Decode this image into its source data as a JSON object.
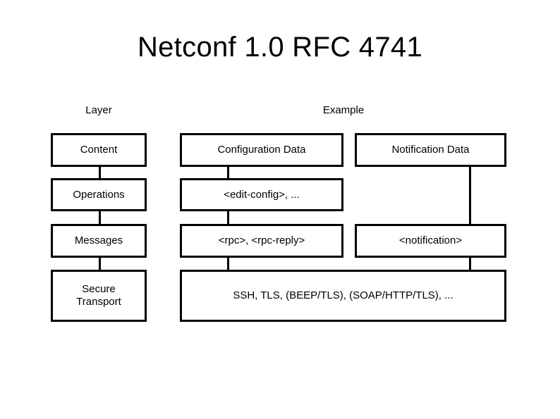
{
  "slide": {
    "title": "Netconf 1.0 RFC 4741",
    "background_color": "#ffffff",
    "line_color": "#000000"
  },
  "columns": {
    "layer_header": "Layer",
    "example_header": "Example"
  },
  "diagram": {
    "type": "layered-block-diagram",
    "layers": [
      {
        "layer": "Content",
        "examples": [
          "Configuration Data",
          "Notification Data"
        ]
      },
      {
        "layer": "Operations",
        "examples": [
          "<edit-config>, ..."
        ]
      },
      {
        "layer": "Messages",
        "examples": [
          "<rpc>, <rpc-reply>",
          "<notification>"
        ]
      },
      {
        "layer": "Secure\nTransport",
        "examples": [
          "SSH, TLS, (BEEP/TLS), (SOAP/HTTP/TLS), ..."
        ]
      }
    ],
    "layer_boxes": {
      "content": "Content",
      "operations": "Operations",
      "messages": "Messages",
      "secure_transport": "Secure\nTransport"
    },
    "example_boxes": {
      "configuration_data": "Configuration Data",
      "notification_data": "Notification Data",
      "edit_config": "<edit-config>, ...",
      "rpc": "<rpc>, <rpc-reply>",
      "notification": "<notification>",
      "transport": "SSH, TLS, (BEEP/TLS), (SOAP/HTTP/TLS), ..."
    }
  }
}
